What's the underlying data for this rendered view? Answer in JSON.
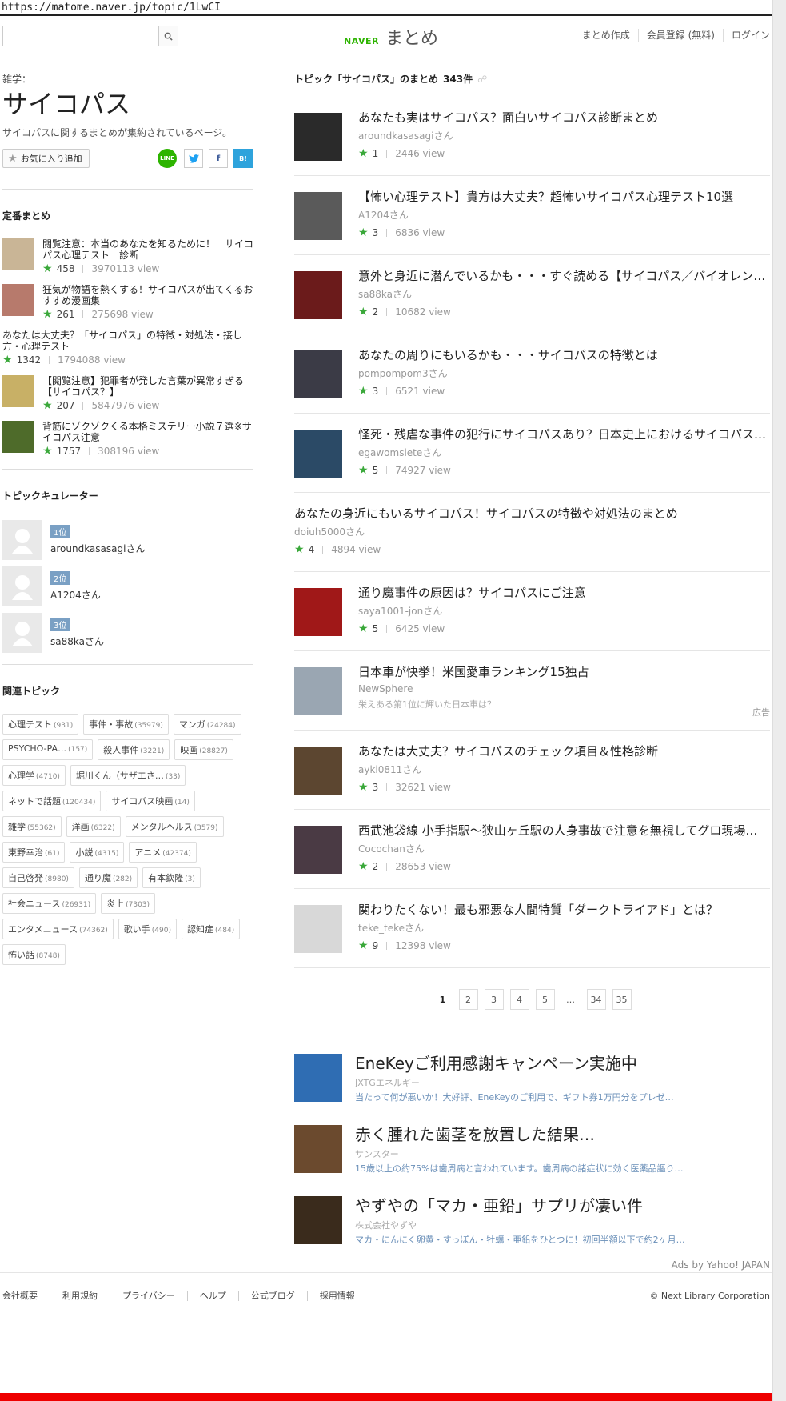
{
  "browser": {
    "url": "https://matome.naver.jp/topic/1LwCI"
  },
  "header": {
    "search_placeholder": "",
    "logo_naver": "NAVER",
    "logo_matome": "まとめ",
    "nav": [
      "まとめ作成",
      "会員登録 (無料)",
      "ログイン"
    ]
  },
  "topic": {
    "kicker": "雑学：",
    "title": "サイコパス",
    "description": "サイコパスに関するまとめが集約されているページ。",
    "favorite_label": "お気に入り追加",
    "share": {
      "line": "LINE",
      "twitter": "t",
      "facebook": "f",
      "hatena": "B!"
    }
  },
  "standard": {
    "title": "定番まとめ",
    "items": [
      {
        "title": "閲覧注意：本当のあなたを知るために！　サイコパス心理テスト　診断",
        "favs": "458",
        "views": "3970113 view",
        "thumb_color": "#c9b596"
      },
      {
        "title": "狂気が物語を熱くする！サイコパスが出てくるおすすめ漫画集",
        "favs": "261",
        "views": "275698 view",
        "thumb_color": "#b77a6c"
      },
      {
        "title": "あなたは大丈夫？「サイコパス」の特徴・対処法・接し方・心理テスト",
        "favs": "1342",
        "views": "1794088 view",
        "thumb_color": ""
      },
      {
        "title": "【閲覧注意】犯罪者が発した言葉が異常すぎる【サイコパス？】",
        "favs": "207",
        "views": "5847976 view",
        "thumb_color": "#c8b066"
      },
      {
        "title": "背筋にゾクゾクくる本格ミステリー小説７選※サイコパス注意",
        "favs": "1757",
        "views": "308196 view",
        "thumb_color": "#4e6b2a"
      }
    ]
  },
  "curators": {
    "title": "トピックキュレーター",
    "items": [
      {
        "rank": "1位",
        "name": "aroundkasasagiさん"
      },
      {
        "rank": "2位",
        "name": "A1204さん"
      },
      {
        "rank": "3位",
        "name": "sa88kaさん"
      }
    ]
  },
  "related": {
    "title": "関連トピック",
    "tags": [
      {
        "name": "心理テスト",
        "count": "(931)"
      },
      {
        "name": "事件・事故",
        "count": "(35979)"
      },
      {
        "name": "マンガ",
        "count": "(24284)"
      },
      {
        "name": "PSYCHO-PA…",
        "count": "(157)"
      },
      {
        "name": "殺人事件",
        "count": "(3221)"
      },
      {
        "name": "映画",
        "count": "(28827)"
      },
      {
        "name": "心理学",
        "count": "(4710)"
      },
      {
        "name": "堀川くん（サザエさ…",
        "count": "(33)"
      },
      {
        "name": "ネットで話題",
        "count": "(120434)"
      },
      {
        "name": "サイコパス映画",
        "count": "(14)"
      },
      {
        "name": "雑学",
        "count": "(55362)"
      },
      {
        "name": "洋画",
        "count": "(6322)"
      },
      {
        "name": "メンタルヘルス",
        "count": "(3579)"
      },
      {
        "name": "東野幸治",
        "count": "(61)"
      },
      {
        "name": "小説",
        "count": "(4315)"
      },
      {
        "name": "アニメ",
        "count": "(42374)"
      },
      {
        "name": "自己啓発",
        "count": "(8980)"
      },
      {
        "name": "通り魔",
        "count": "(282)"
      },
      {
        "name": "有本欽隆",
        "count": "(3)"
      },
      {
        "name": "社会ニュース",
        "count": "(26931)"
      },
      {
        "name": "炎上",
        "count": "(7303)"
      },
      {
        "name": "エンタメニュース",
        "count": "(74362)"
      },
      {
        "name": "歌い手",
        "count": "(490)"
      },
      {
        "name": "認知症",
        "count": "(484)"
      },
      {
        "name": "怖い話",
        "count": "(8748)"
      }
    ]
  },
  "main": {
    "heading": "トピック「サイコパス」のまとめ",
    "count": "343件",
    "rss": "☍",
    "items": [
      {
        "title": "あなたも実はサイコパス？面白いサイコパス診断まとめ",
        "author": "aroundkasasagiさん",
        "favs": "1",
        "views": "2446 view",
        "thumb_color": "#2a2a2a"
      },
      {
        "title": "【怖い心理テスト】貴方は大丈夫？超怖いサイコパス心理テスト10選",
        "author": "A1204さん",
        "favs": "3",
        "views": "6836 view",
        "thumb_color": "#5a5a5a"
      },
      {
        "title": "意外と身近に潜んでいるかも・・・すぐ読める【サイコパス／バイオレン…",
        "author": "sa88kaさん",
        "favs": "2",
        "views": "10682 view",
        "thumb_color": "#6b1b1b"
      },
      {
        "title": "あなたの周りにもいるかも・・・サイコパスの特徴とは",
        "author": "pompompom3さん",
        "favs": "3",
        "views": "6521 view",
        "thumb_color": "#3b3b46"
      },
      {
        "title": "怪死・残虐な事件の犯行にサイコパスあり？日本史上におけるサイコパス…",
        "author": "egawomsieteさん",
        "favs": "5",
        "views": "74927 view",
        "thumb_color": "#2b4a66"
      },
      {
        "title": "あなたの身近にもいるサイコパス！サイコパスの特徴や対処法のまとめ",
        "author": "doiuh5000さん",
        "favs": "4",
        "views": "4894 view",
        "thumb_color": ""
      },
      {
        "title": "通り魔事件の原因は？サイコパスにご注意",
        "author": "saya1001-jonさん",
        "favs": "5",
        "views": "6425 view",
        "thumb_color": "#a01818"
      },
      {
        "title": "日本車が快挙！米国愛車ランキング15独占",
        "author": "NewSphere",
        "sub": "栄えある第1位に輝いた日本車は？",
        "ad_label": "広告",
        "thumb_color": "#9aa6b2"
      },
      {
        "title": "あなたは大丈夫？サイコパスのチェック項目＆性格診断",
        "author": "ayki0811さん",
        "favs": "3",
        "views": "32621 view",
        "thumb_color": "#5c4630"
      },
      {
        "title": "西武池袋線 小手指駅〜狭山ヶ丘駅の人身事故で注意を無視してグロ現場…",
        "author": "Cocochanさん",
        "favs": "2",
        "views": "28653 view",
        "thumb_color": "#4a3a44"
      },
      {
        "title": "関わりたくない！最も邪悪な人間特質「ダークトライアド」とは？",
        "author": "teke_tekeさん",
        "favs": "9",
        "views": "12398 view",
        "thumb_color": "#d8d8d8"
      }
    ]
  },
  "pager": {
    "pages": [
      "1",
      "2",
      "3",
      "4",
      "5",
      "…",
      "34",
      "35"
    ],
    "current": "1"
  },
  "ads": {
    "items": [
      {
        "title": "EneKeyご利用感謝キャンペーン実施中",
        "sponsor": "JXTGエネルギー",
        "desc": "当たって何が悪いか！大好評、EneKeyのご利用で、ギフト券1万円分をプレゼ…",
        "thumb_color": "#2f6db3"
      },
      {
        "title": "赤く腫れた歯茎を放置した結果…",
        "sponsor": "サンスター",
        "desc": "15歳以上の約75%は歯周病と言われています。歯周病の諸症状に効く医薬品謳り…",
        "thumb_color": "#6b4a2e"
      },
      {
        "title": "やずやの「マカ・亜鉛」サプリが凄い件",
        "sponsor": "株式会社やずや",
        "desc": "マカ・にんにく卵黄・すっぽん・牡蠣・亜鉛をひとつに！初回半額以下で約2ヶ月分…",
        "thumb_color": "#3a2b1c"
      }
    ],
    "by": "Ads by Yahoo! JAPAN"
  },
  "footer": {
    "links": [
      "会社概要",
      "利用規約",
      "プライバシー",
      "ヘルプ",
      "公式ブログ",
      "採用情報"
    ],
    "copyright": "© Next Library Corporation"
  }
}
